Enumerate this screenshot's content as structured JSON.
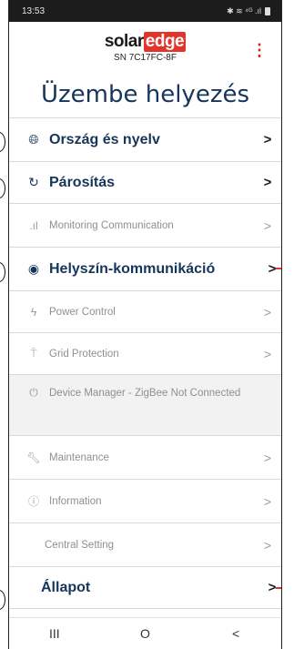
{
  "status_bar": {
    "time": "13:53",
    "icons": "✱ ≋ ⁴ᴳ .ıl"
  },
  "header": {
    "brand_solar": "solar",
    "brand_edge": "edge",
    "serial": "SN 7C17FC-8F",
    "menu_icon": "⋮"
  },
  "page_title": "Üzembe helyezés",
  "menu": {
    "items": [
      {
        "label": "Ország és nyelv",
        "icon": "globe-icon",
        "glyph": "🌐︎"
      },
      {
        "label": "Párosítás",
        "icon": "pairing-icon",
        "glyph": "↻"
      },
      {
        "label": "Monitoring Communication",
        "icon": "signal-bars-icon",
        "glyph": ".ıl"
      },
      {
        "label": "Helyszín-kommunikáció",
        "icon": "location-pin-icon",
        "glyph": "◉"
      },
      {
        "label": "Power Control",
        "icon": "lightning-icon",
        "glyph": "ϟ"
      },
      {
        "label": "Grid Protection",
        "icon": "power-tower-icon",
        "glyph": "⍑"
      },
      {
        "label": "Device Manager - ZigBee Not Connected",
        "icon": "plug-icon",
        "glyph": "⏻"
      },
      {
        "label": "Maintenance",
        "icon": "wrench-icon",
        "glyph": "🔧︎"
      },
      {
        "label": "Information",
        "icon": "info-icon",
        "glyph": "ⓘ"
      },
      {
        "label": "Central Setting",
        "icon": "",
        "glyph": ""
      },
      {
        "label": "Állapot",
        "icon": "",
        "glyph": ""
      }
    ],
    "chevron": ">"
  },
  "nav": {
    "recent": "III",
    "home": "O",
    "back": "<"
  },
  "colors": {
    "accent_red": "#e2342a",
    "title_navy": "#16355b"
  }
}
